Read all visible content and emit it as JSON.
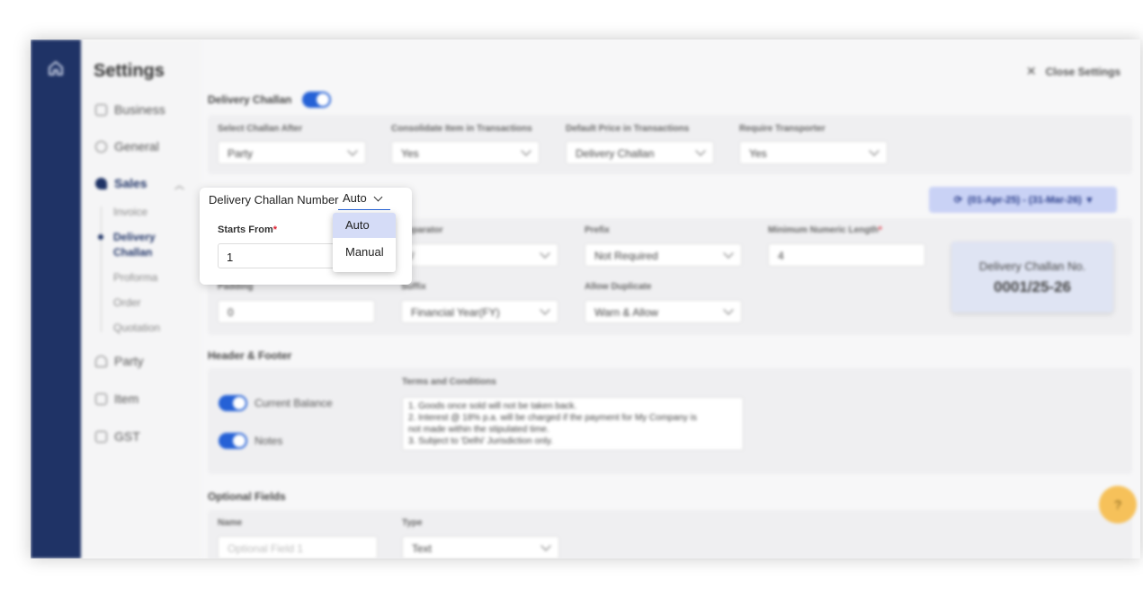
{
  "app": {
    "title": "Settings",
    "close_label": "Close Settings"
  },
  "sidebar": {
    "items": [
      {
        "label": "Business",
        "icon": "briefcase-icon"
      },
      {
        "label": "General",
        "icon": "gear-icon"
      },
      {
        "label": "Sales",
        "icon": "tag-icon"
      },
      {
        "label": "Party",
        "icon": "user-icon"
      },
      {
        "label": "Item",
        "icon": "tag-outline-icon"
      },
      {
        "label": "GST",
        "icon": "receipt-icon"
      }
    ],
    "sales_sub": [
      "Invoice",
      "Delivery",
      "Challan",
      "Proforma",
      "Order",
      "Quotation"
    ]
  },
  "delivery": {
    "section_label": "Delivery Challan",
    "fields": [
      {
        "label": "Select Challan After",
        "value": "Party"
      },
      {
        "label": "Consolidate Item in Transactions",
        "value": "Yes"
      },
      {
        "label": "Default Price in Transactions",
        "value": "Delivery Challan"
      },
      {
        "label": "Require Transporter",
        "value": "Yes"
      }
    ]
  },
  "numbering": {
    "fy_range": "(01-Apr-25) - (31-Mar-26)",
    "separator_label": "Separator",
    "separator_value": "/",
    "prefix_label": "Prefix",
    "prefix_value": "Not Required",
    "min_len_label": "Minimum Numeric Length",
    "min_len_value": "4",
    "padding_label": "Padding",
    "padding_value": "0",
    "suffix_label": "Suffix",
    "suffix_value": "Financial Year(FY)",
    "duplicate_label": "Allow Duplicate",
    "duplicate_value": "Warn & Allow",
    "preview_title": "Delivery Challan No.",
    "preview_number": "0001/25-26"
  },
  "popover": {
    "title": "Delivery Challan Number",
    "mode_value": "Auto",
    "starts_from_label": "Starts From",
    "required_mark": "*",
    "starts_from_value": "1",
    "options": [
      "Auto",
      "Manual"
    ]
  },
  "header_footer": {
    "section_label": "Header & Footer",
    "current_balance_label": "Current Balance",
    "notes_label": "Notes",
    "terms_label": "Terms and Conditions",
    "terms_lines": [
      "1. Goods once sold will not be taken back.",
      "2. Interest @ 18% p.a. will be charged if the payment for My Company is",
      "not made within the stipulated time.",
      "3. Subject to 'Delhi' Jurisdiction only."
    ]
  },
  "optional_fields": {
    "section_label": "Optional Fields",
    "name_label": "Name",
    "name_placeholder": "Optional Field 1",
    "type_label": "Type",
    "type_value": "Text"
  },
  "colors": {
    "rail": "#1f3366",
    "accent": "#2561d6",
    "help": "#f6c15a"
  }
}
